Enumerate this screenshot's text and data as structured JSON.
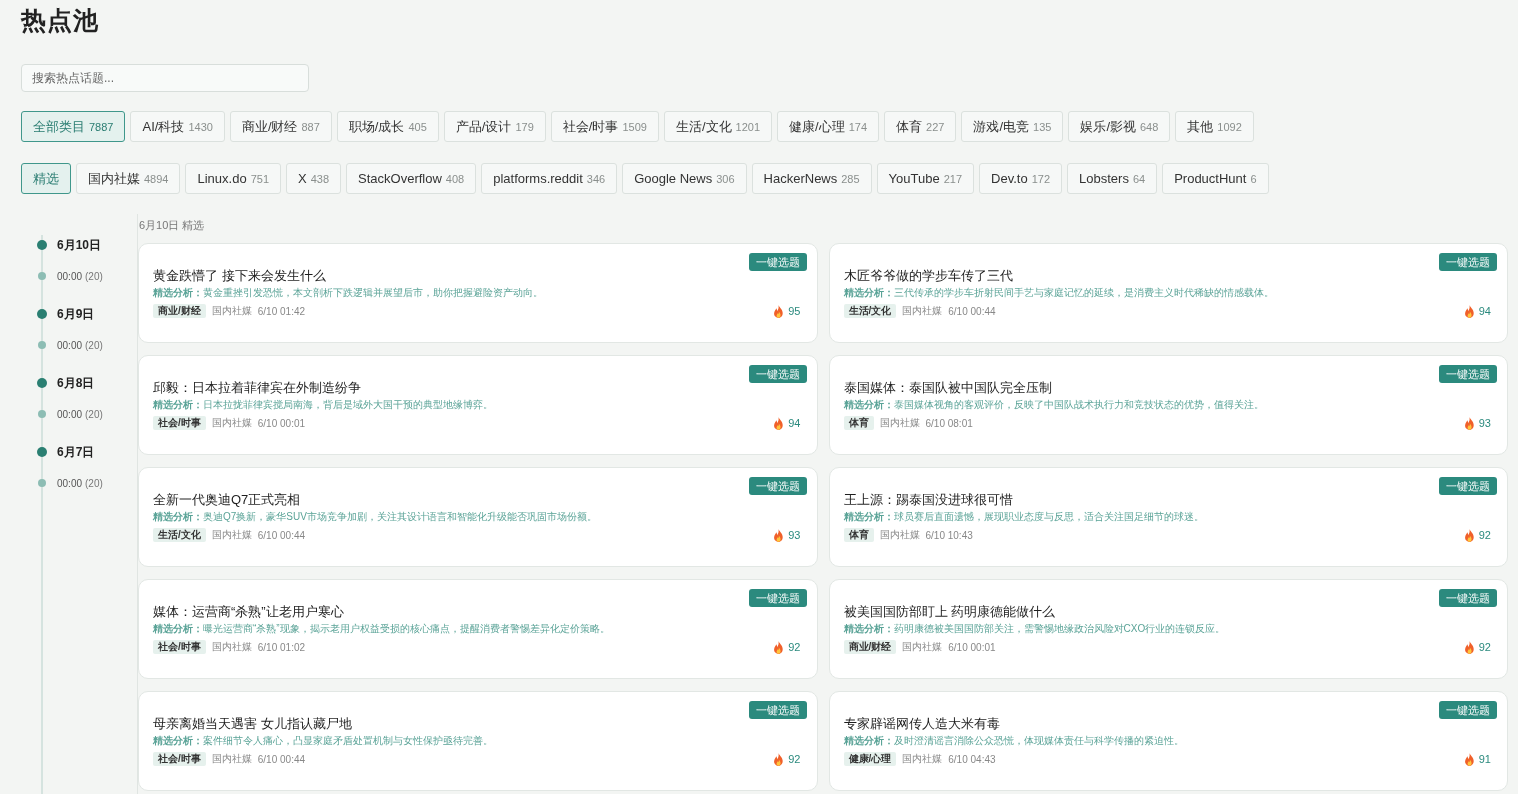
{
  "page": {
    "title": "热点池"
  },
  "search": {
    "placeholder": "搜索热点话题..."
  },
  "category_filters": [
    {
      "label": "全部类目",
      "count": "7887",
      "selected": true
    },
    {
      "label": "AI/科技",
      "count": "1430",
      "selected": false
    },
    {
      "label": "商业/财经",
      "count": "887",
      "selected": false
    },
    {
      "label": "职场/成长",
      "count": "405",
      "selected": false
    },
    {
      "label": "产品/设计",
      "count": "179",
      "selected": false
    },
    {
      "label": "社会/时事",
      "count": "1509",
      "selected": false
    },
    {
      "label": "生活/文化",
      "count": "1201",
      "selected": false
    },
    {
      "label": "健康/心理",
      "count": "174",
      "selected": false
    },
    {
      "label": "体育",
      "count": "227",
      "selected": false
    },
    {
      "label": "游戏/电竞",
      "count": "135",
      "selected": false
    },
    {
      "label": "娱乐/影视",
      "count": "648",
      "selected": false
    },
    {
      "label": "其他",
      "count": "1092",
      "selected": false
    }
  ],
  "source_filters": [
    {
      "label": "精选",
      "selected": true
    },
    {
      "label": "国内社媒",
      "count": "4894",
      "selected": false
    },
    {
      "label": "Linux.do",
      "count": "751",
      "selected": false
    },
    {
      "label": "X",
      "count": "438",
      "selected": false
    },
    {
      "label": "StackOverflow",
      "count": "408",
      "selected": false
    },
    {
      "label": "platforms.reddit",
      "count": "346",
      "selected": false
    },
    {
      "label": "Google News",
      "count": "306",
      "selected": false
    },
    {
      "label": "HackerNews",
      "count": "285",
      "selected": false
    },
    {
      "label": "YouTube",
      "count": "217",
      "selected": false
    },
    {
      "label": "Dev.to",
      "count": "172",
      "selected": false
    },
    {
      "label": "Lobsters",
      "count": "64",
      "selected": false
    },
    {
      "label": "ProductHunt",
      "count": "6",
      "selected": false
    }
  ],
  "timeline": [
    {
      "date": "6月10日",
      "slots": [
        {
          "time": "00:00",
          "count": "(20)"
        }
      ]
    },
    {
      "date": "6月9日",
      "slots": [
        {
          "time": "00:00",
          "count": "(20)"
        }
      ]
    },
    {
      "date": "6月8日",
      "slots": [
        {
          "time": "00:00",
          "count": "(20)"
        }
      ]
    },
    {
      "date": "6月7日",
      "slots": [
        {
          "time": "00:00",
          "count": "(20)"
        }
      ]
    }
  ],
  "feed": {
    "heading": "6月10日 精选",
    "cards": [
      {
        "title": "黄金跌懵了 接下来会发生什么",
        "pick_button": "一键选题",
        "analysis": "**精选分析：**黄金重挫引发恐慌，本文剖析下跌逻辑并展望后市，助你把握避险资产动向。",
        "tag": "商业/财经",
        "source": "国内社媒",
        "time": "6/10 01:42",
        "score": "95"
      },
      {
        "title": "木匠爷爷做的学步车传了三代",
        "pick_button": "一键选题",
        "analysis": "**精选分析：**三代传承的学步车折射民间手艺与家庭记忆的延续，是消费主义时代稀缺的情感载体。",
        "tag": "生活/文化",
        "source": "国内社媒",
        "time": "6/10 00:44",
        "score": "94"
      },
      {
        "title": "邱毅：日本拉着菲律宾在外制造纷争",
        "pick_button": "一键选题",
        "analysis": "**精选分析：**日本拉拢菲律宾搅局南海，背后是域外大国干预的典型地缘博弈。",
        "tag": "社会/时事",
        "source": "国内社媒",
        "time": "6/10 00:01",
        "score": "94"
      },
      {
        "title": "泰国媒体：泰国队被中国队完全压制",
        "pick_button": "一键选题",
        "analysis": "**精选分析：**泰国媒体视角的客观评价，反映了中国队战术执行力和竞技状态的优势，值得关注。",
        "tag": "体育",
        "source": "国内社媒",
        "time": "6/10 08:01",
        "score": "93"
      },
      {
        "title": "全新一代奥迪Q7正式亮相",
        "pick_button": "一键选题",
        "analysis": "**精选分析：**奥迪Q7换新，豪华SUV市场竞争加剧，关注其设计语言和智能化升级能否巩固市场份额。",
        "tag": "生活/文化",
        "source": "国内社媒",
        "time": "6/10 00:44",
        "score": "93"
      },
      {
        "title": "王上源：踢泰国没进球很可惜",
        "pick_button": "一键选题",
        "analysis": "**精选分析：**球员赛后直面遗憾，展现职业态度与反思，适合关注国足细节的球迷。",
        "tag": "体育",
        "source": "国内社媒",
        "time": "6/10 10:43",
        "score": "92"
      },
      {
        "title": "媒体：运营商“杀熟”让老用户寒心",
        "pick_button": "一键选题",
        "analysis": "**精选分析：**曝光运营商“杀熟”现象，揭示老用户权益受损的核心痛点，提醒消费者警惕差异化定价策略。",
        "tag": "社会/时事",
        "source": "国内社媒",
        "time": "6/10 01:02",
        "score": "92"
      },
      {
        "title": "被美国国防部盯上 药明康德能做什么",
        "pick_button": "一键选题",
        "analysis": "**精选分析：**药明康德被美国国防部关注，需警惕地缘政治风险对CXO行业的连锁反应。",
        "tag": "商业/财经",
        "source": "国内社媒",
        "time": "6/10 00:01",
        "score": "92"
      },
      {
        "title": "母亲离婚当天遇害 女儿指认藏尸地",
        "pick_button": "一键选题",
        "analysis": "**精选分析：**案件细节令人痛心，凸显家庭矛盾处置机制与女性保护亟待完善。",
        "tag": "社会/时事",
        "source": "国内社媒",
        "time": "6/10 00:44",
        "score": "92"
      },
      {
        "title": "专家辟谣网传人造大米有毒",
        "pick_button": "一键选题",
        "analysis": "**精选分析：**及时澄清谣言消除公众恐慌，体现媒体责任与科学传播的紧迫性。",
        "tag": "健康/心理",
        "source": "国内社媒",
        "time": "6/10 04:43",
        "score": "91"
      }
    ]
  }
}
